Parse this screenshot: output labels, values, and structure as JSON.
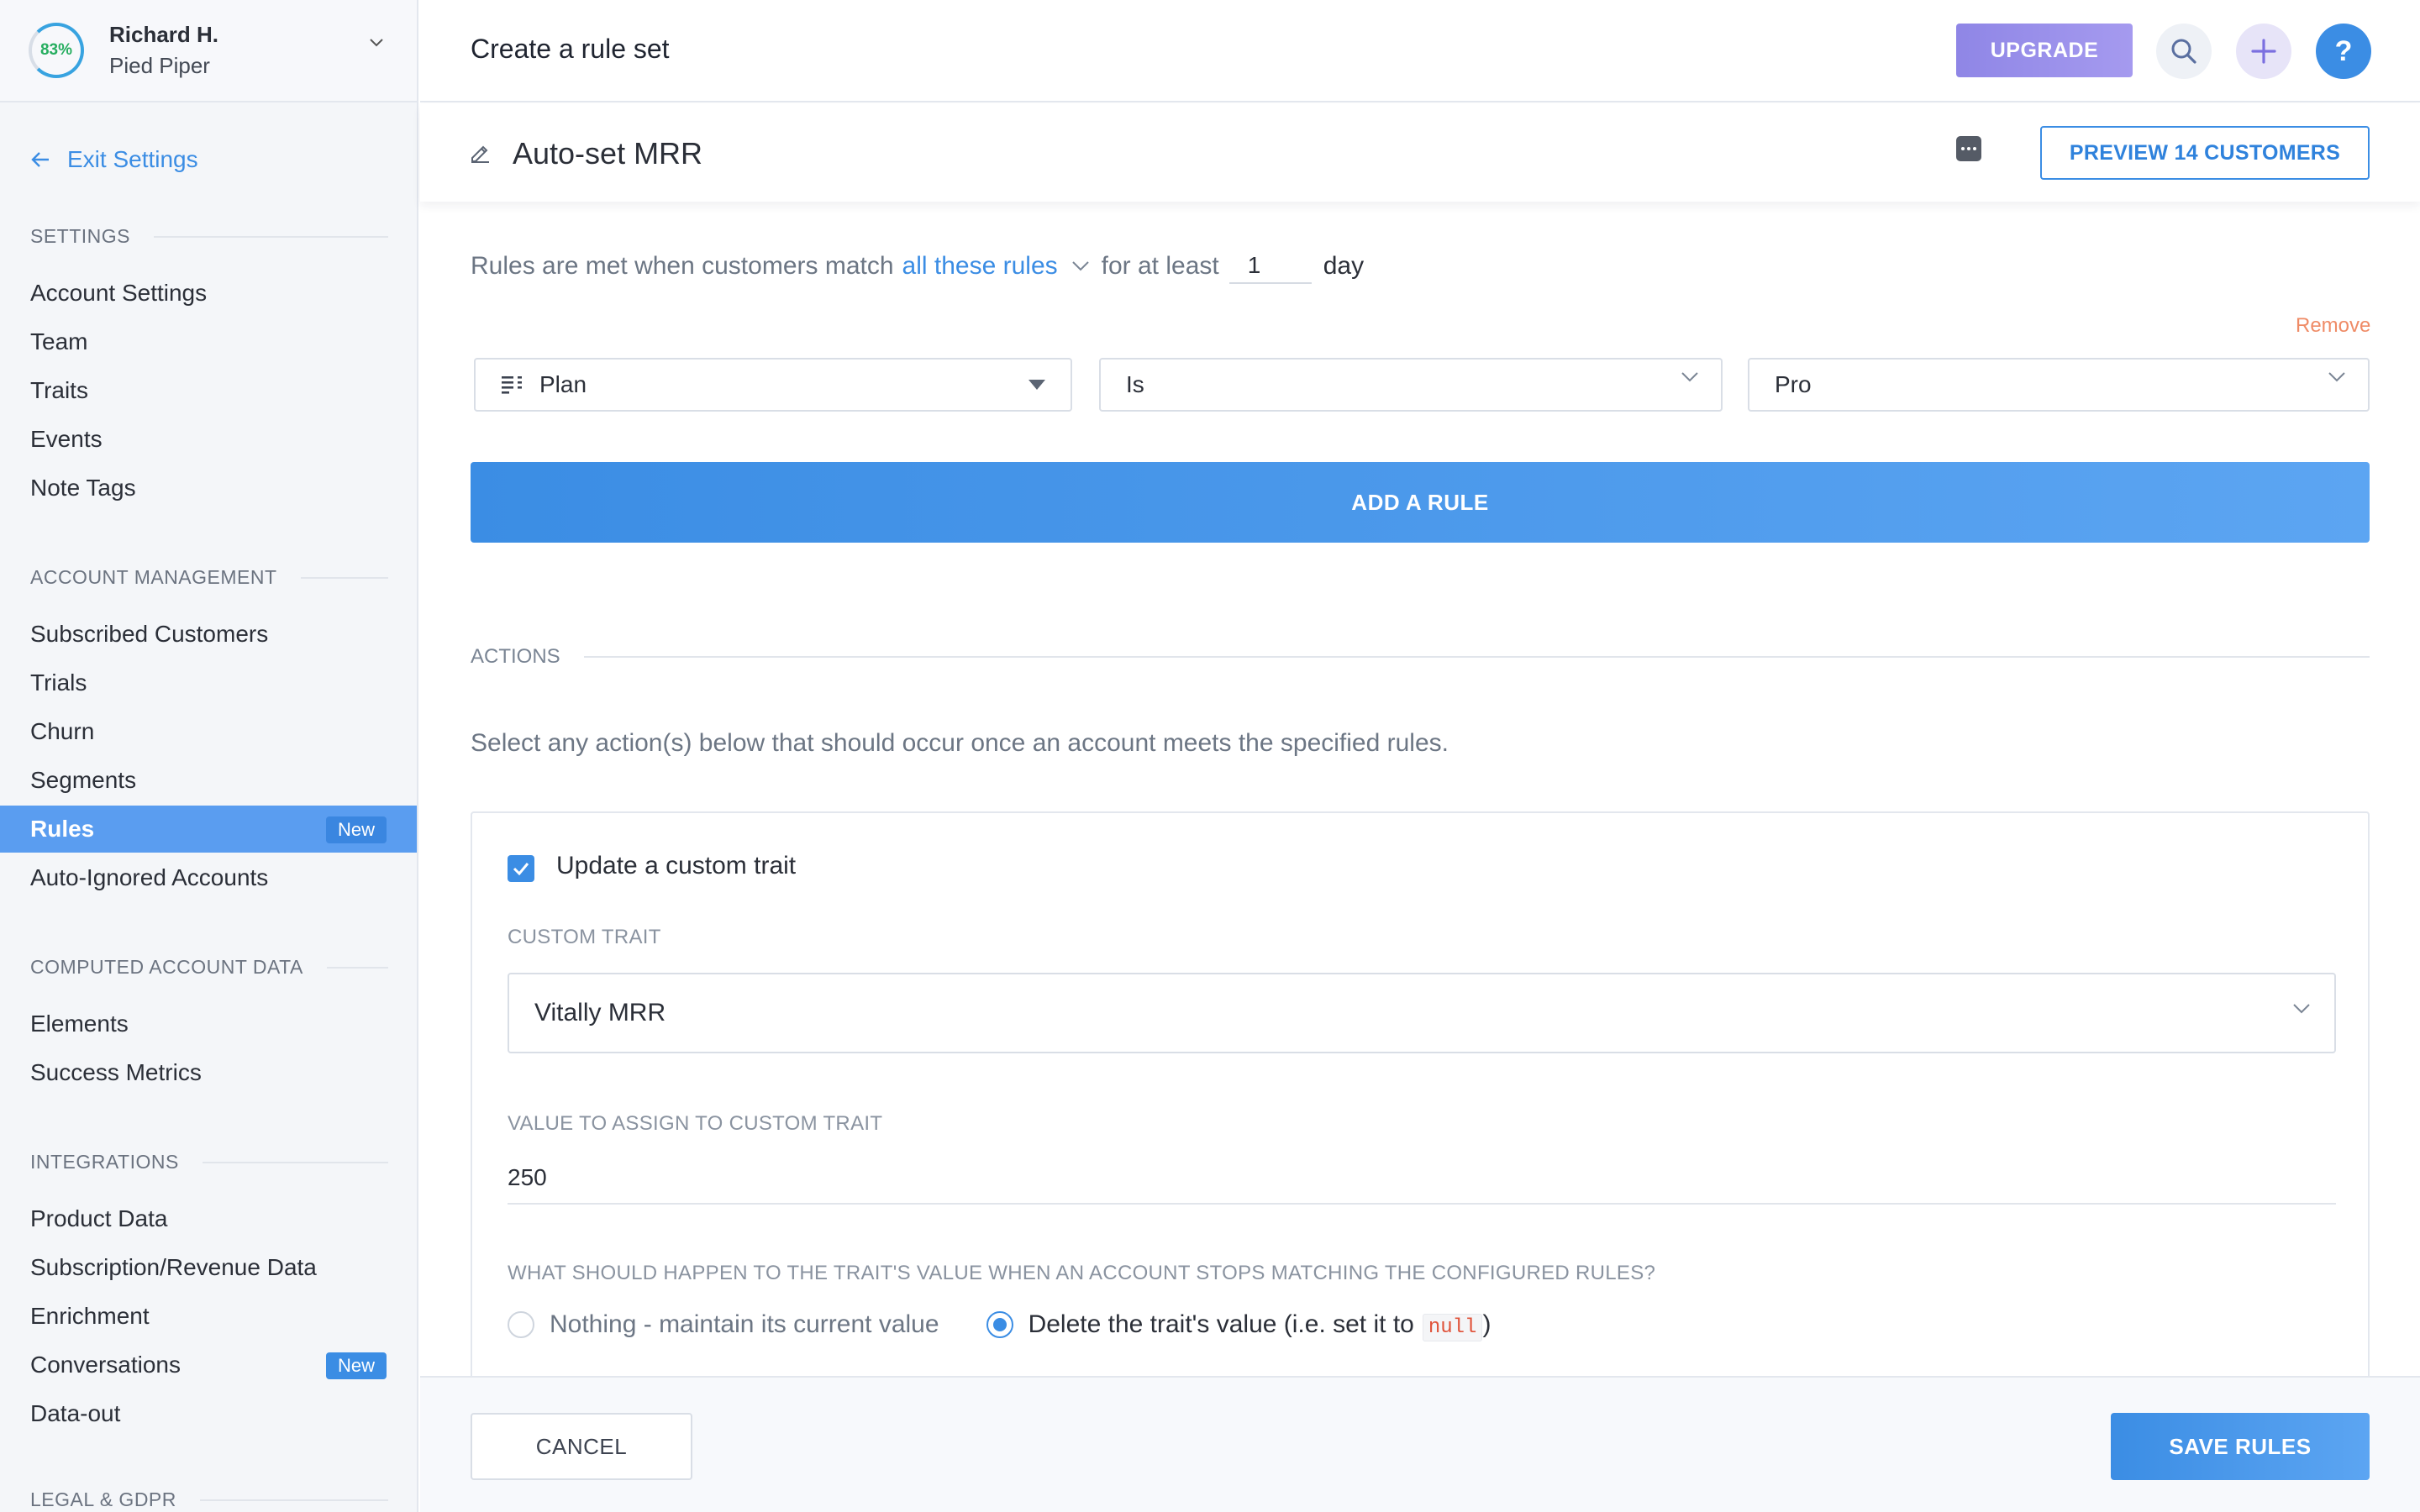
{
  "account": {
    "progress": "83%",
    "user_name": "Richard H.",
    "company": "Pied Piper"
  },
  "sidebar": {
    "exit_label": "Exit Settings",
    "sections": [
      {
        "title": "SETTINGS",
        "items": [
          {
            "label": "Account Settings"
          },
          {
            "label": "Team"
          },
          {
            "label": "Traits"
          },
          {
            "label": "Events"
          },
          {
            "label": "Note Tags"
          }
        ]
      },
      {
        "title": "ACCOUNT MANAGEMENT",
        "items": [
          {
            "label": "Subscribed Customers"
          },
          {
            "label": "Trials"
          },
          {
            "label": "Churn"
          },
          {
            "label": "Segments"
          },
          {
            "label": "Rules",
            "badge": "New",
            "active": true
          },
          {
            "label": "Auto-Ignored Accounts"
          }
        ]
      },
      {
        "title": "COMPUTED ACCOUNT DATA",
        "items": [
          {
            "label": "Elements"
          },
          {
            "label": "Success Metrics"
          }
        ]
      },
      {
        "title": "INTEGRATIONS",
        "items": [
          {
            "label": "Product Data"
          },
          {
            "label": "Subscription/Revenue Data"
          },
          {
            "label": "Enrichment"
          },
          {
            "label": "Conversations",
            "badge": "New"
          },
          {
            "label": "Data-out"
          }
        ]
      },
      {
        "title": "LEGAL & GDPR",
        "items": []
      }
    ]
  },
  "header": {
    "title": "Create a rule set",
    "upgrade_label": "UPGRADE",
    "help_label": "?"
  },
  "ruleset": {
    "name": "Auto-set MRR",
    "preview_label": "PREVIEW 14 CUSTOMERS"
  },
  "rules": {
    "prefix": "Rules are met when customers match",
    "match_mode": "all these rules",
    "for_at_least": "for at least",
    "days_value": "1",
    "day_unit": "day",
    "remove_label": "Remove",
    "rule": {
      "field": "Plan",
      "operator": "Is",
      "value": "Pro"
    },
    "add_rule_label": "ADD A RULE"
  },
  "actions": {
    "heading": "ACTIONS",
    "description": "Select any action(s) below that should occur once an account meets the specified rules.",
    "update_trait": {
      "label": "Update a custom trait",
      "checked": true,
      "custom_trait_label": "CUSTOM TRAIT",
      "custom_trait_value": "Vitally MRR",
      "assign_label": "VALUE TO ASSIGN TO CUSTOM TRAIT",
      "assign_value": "250",
      "stop_question": "WHAT SHOULD HAPPEN TO THE TRAIT'S VALUE WHEN AN ACCOUNT STOPS MATCHING THE CONFIGURED RULES?",
      "option_keep": "Nothing - maintain its current value",
      "option_delete_prefix": "Delete the trait's value (i.e. set it to",
      "option_delete_code": "null",
      "option_delete_suffix": ")",
      "selected_option": "delete"
    }
  },
  "footer": {
    "cancel_label": "CANCEL",
    "save_label": "SAVE RULES"
  },
  "colors": {
    "accent": "#3b8de4",
    "upgrade": "#9a90eb",
    "remove": "#ef8b66",
    "active_nav": "#5a9df0"
  }
}
